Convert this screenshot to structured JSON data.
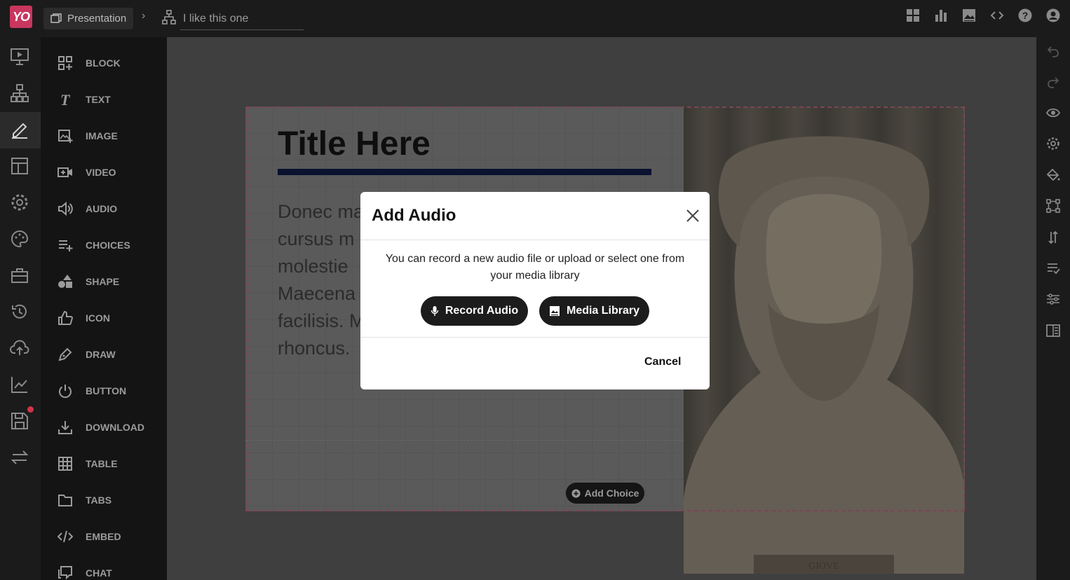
{
  "app": {
    "logo_text": "YO",
    "brand_color": "#c9365f"
  },
  "topbar": {
    "presentation_label": "Presentation",
    "title_value": "I like this one",
    "icons": [
      "grid-icon",
      "bar-chart-icon",
      "image-icon",
      "code-icon",
      "help-icon",
      "account-icon"
    ]
  },
  "left_rail": {
    "icons": [
      "present-icon",
      "sitemap-icon",
      "edit-icon",
      "layout-icon",
      "settings-icon",
      "palette-icon",
      "toolbox-icon",
      "history-icon",
      "upload-icon",
      "analytics-icon",
      "save-icon",
      "swap-icon"
    ],
    "active": "edit-icon"
  },
  "block_panel": {
    "items": [
      {
        "label": "BLOCK",
        "icon": "block-add-icon"
      },
      {
        "label": "TEXT",
        "icon": "text-icon"
      },
      {
        "label": "IMAGE",
        "icon": "image-add-icon"
      },
      {
        "label": "VIDEO",
        "icon": "video-add-icon"
      },
      {
        "label": "AUDIO",
        "icon": "speaker-icon"
      },
      {
        "label": "CHOICES",
        "icon": "choices-icon"
      },
      {
        "label": "SHAPE",
        "icon": "shape-icon"
      },
      {
        "label": "ICON",
        "icon": "thumbs-up-icon"
      },
      {
        "label": "DRAW",
        "icon": "pen-icon"
      },
      {
        "label": "BUTTON",
        "icon": "power-icon"
      },
      {
        "label": "DOWNLOAD",
        "icon": "download-icon"
      },
      {
        "label": "TABLE",
        "icon": "table-icon"
      },
      {
        "label": "TABS",
        "icon": "folder-icon"
      },
      {
        "label": "EMBED",
        "icon": "embed-icon"
      },
      {
        "label": "CHAT",
        "icon": "chat-icon"
      }
    ]
  },
  "slide": {
    "title": "Title Here",
    "body": "Donec mattis, cursus m... molestie ... Maecena... facilisis. M... rhoncus.",
    "body_lines": [
      "Donec ma",
      "cursus m",
      "molestie",
      "Maecena",
      "facilisis. M",
      "rhoncus."
    ],
    "image_caption": "GIOVE",
    "add_choice_label": "Add Choice"
  },
  "right_rail": {
    "icons": [
      "undo-icon",
      "redo-icon",
      "eye-icon",
      "settings-icon",
      "paint-bucket-icon",
      "transform-icon",
      "sort-icon",
      "list-check-icon",
      "sliders-icon",
      "columns-icon"
    ]
  },
  "modal": {
    "title": "Add Audio",
    "description": "You can record a new audio file or upload or select one from your media library",
    "record_label": "Record Audio",
    "media_label": "Media Library",
    "cancel_label": "Cancel"
  }
}
